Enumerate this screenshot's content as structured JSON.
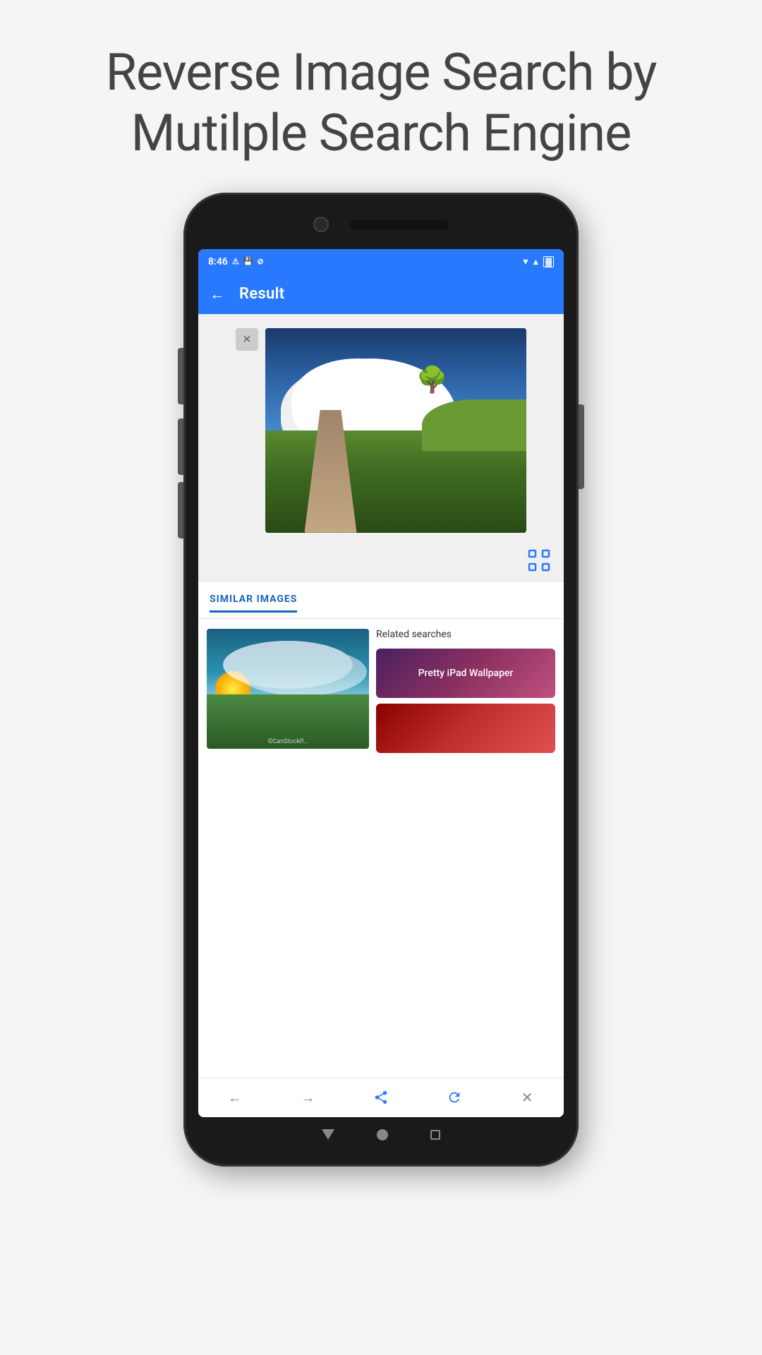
{
  "headline": {
    "line1": "Reverse Image Search by",
    "line2": "Mutilple Search Engine"
  },
  "status_bar": {
    "time": "8:46",
    "wifi": "▼",
    "signal": "▲",
    "battery": "🔋"
  },
  "app_bar": {
    "back_label": "←",
    "title": "Result"
  },
  "image_section": {
    "close_button_label": "✕",
    "watermark": "©CanStockP..."
  },
  "icon_section": {
    "scan_icon_name": "scan-search-icon"
  },
  "similar_images": {
    "tab_label": "SIMILAR IMAGES"
  },
  "related_searches": {
    "label": "Related searches",
    "items": [
      {
        "id": 1,
        "text": "Pretty iPad Wallpaper"
      },
      {
        "id": 2,
        "text": ""
      }
    ]
  },
  "bottom_nav": {
    "back_label": "←",
    "forward_label": "→",
    "share_label": "⤴",
    "refresh_label": "↻",
    "close_label": "✕"
  }
}
